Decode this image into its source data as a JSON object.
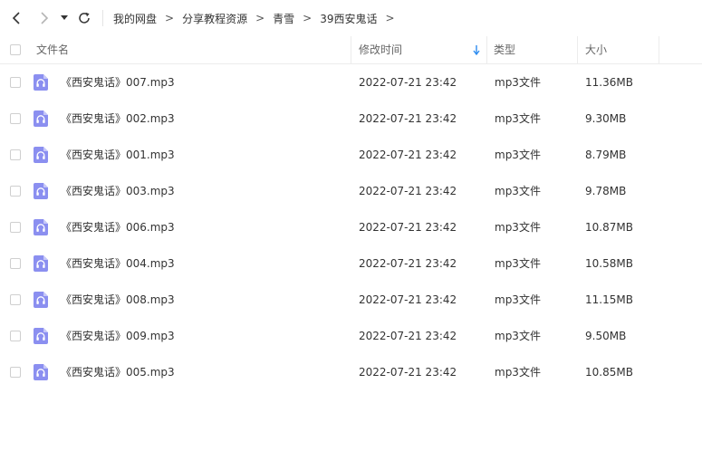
{
  "breadcrumb": [
    "我的网盘",
    "分享教程资源",
    "青雪",
    "39西安鬼话"
  ],
  "breadcrumb_sep": ">",
  "columns": {
    "name": "文件名",
    "modified": "修改时间",
    "type": "类型",
    "size": "大小"
  },
  "files": [
    {
      "name": "《西安鬼话》007.mp3",
      "modified": "2022-07-21 23:42",
      "type": "mp3文件",
      "size": "11.36MB"
    },
    {
      "name": "《西安鬼话》002.mp3",
      "modified": "2022-07-21 23:42",
      "type": "mp3文件",
      "size": "9.30MB"
    },
    {
      "name": "《西安鬼话》001.mp3",
      "modified": "2022-07-21 23:42",
      "type": "mp3文件",
      "size": "8.79MB"
    },
    {
      "name": "《西安鬼话》003.mp3",
      "modified": "2022-07-21 23:42",
      "type": "mp3文件",
      "size": "9.78MB"
    },
    {
      "name": "《西安鬼话》006.mp3",
      "modified": "2022-07-21 23:42",
      "type": "mp3文件",
      "size": "10.87MB"
    },
    {
      "name": "《西安鬼话》004.mp3",
      "modified": "2022-07-21 23:42",
      "type": "mp3文件",
      "size": "10.58MB"
    },
    {
      "name": "《西安鬼话》008.mp3",
      "modified": "2022-07-21 23:42",
      "type": "mp3文件",
      "size": "11.15MB"
    },
    {
      "name": "《西安鬼话》009.mp3",
      "modified": "2022-07-21 23:42",
      "type": "mp3文件",
      "size": "9.50MB"
    },
    {
      "name": "《西安鬼话》005.mp3",
      "modified": "2022-07-21 23:42",
      "type": "mp3文件",
      "size": "10.85MB"
    }
  ],
  "colors": {
    "icon_bg": "#8b8ff0",
    "sort_arrow": "#2d8cf0"
  },
  "icons": {
    "back": "chevron-left-icon",
    "forward": "chevron-right-icon",
    "history": "caret-down-icon",
    "refresh": "refresh-icon",
    "file": "audio-file-icon",
    "sort": "sort-down-arrow-icon"
  }
}
